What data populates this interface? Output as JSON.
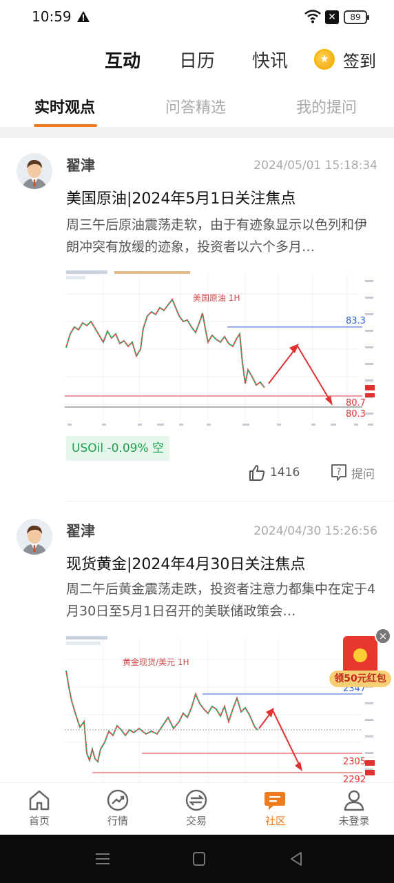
{
  "status_bar": {
    "time": "10:59",
    "battery": "89"
  },
  "top_nav": {
    "tabs": [
      {
        "label": "互动",
        "active": true
      },
      {
        "label": "日历",
        "active": false
      },
      {
        "label": "快讯",
        "active": false
      }
    ],
    "signin_label": "签到"
  },
  "sub_nav": {
    "tabs": [
      {
        "label": "实时观点",
        "active": true
      },
      {
        "label": "问答精选",
        "active": false
      },
      {
        "label": "我的提问",
        "active": false
      }
    ]
  },
  "posts": [
    {
      "author": "翟津",
      "time": "2024/05/01 15:18:34",
      "title": "美国原油|2024年5月1日关注焦点",
      "body": "周三午后原油震荡走软，由于有迹象显示以色列和伊朗冲突有放缓的迹象，投资者以六个多月…",
      "chart": {
        "title": "美国原油 1H",
        "levels": [
          "83.3",
          "80.7",
          "80.3"
        ]
      },
      "tag": "USOil  -0.09%  空",
      "likes": "1416",
      "ask_label": "提问"
    },
    {
      "author": "翟津",
      "time": "2024/04/30 15:26:56",
      "title": "现货黄金|2024年4月30日关注焦点",
      "body": "周二午后黄金震荡走跌，投资者注意力都集中在定于4月30日至5月1日召开的美联储政策会…",
      "chart": {
        "title": "黄金现货/美元 1H",
        "levels": [
          "2347",
          "2305",
          "2292"
        ]
      }
    }
  ],
  "promo": {
    "label": "领50元红包"
  },
  "bottom_nav": {
    "items": [
      {
        "label": "首页",
        "icon": "home-icon",
        "active": false
      },
      {
        "label": "行情",
        "icon": "market-icon",
        "active": false
      },
      {
        "label": "交易",
        "icon": "trade-icon",
        "active": false
      },
      {
        "label": "社区",
        "icon": "community-icon",
        "active": true
      },
      {
        "label": "未登录",
        "icon": "user-icon",
        "active": false
      }
    ]
  },
  "colors": {
    "accent": "#f07b1d",
    "tag_green": "#1ca04b",
    "chart_red": "#e03030",
    "chart_blue": "#2c5fd6"
  }
}
